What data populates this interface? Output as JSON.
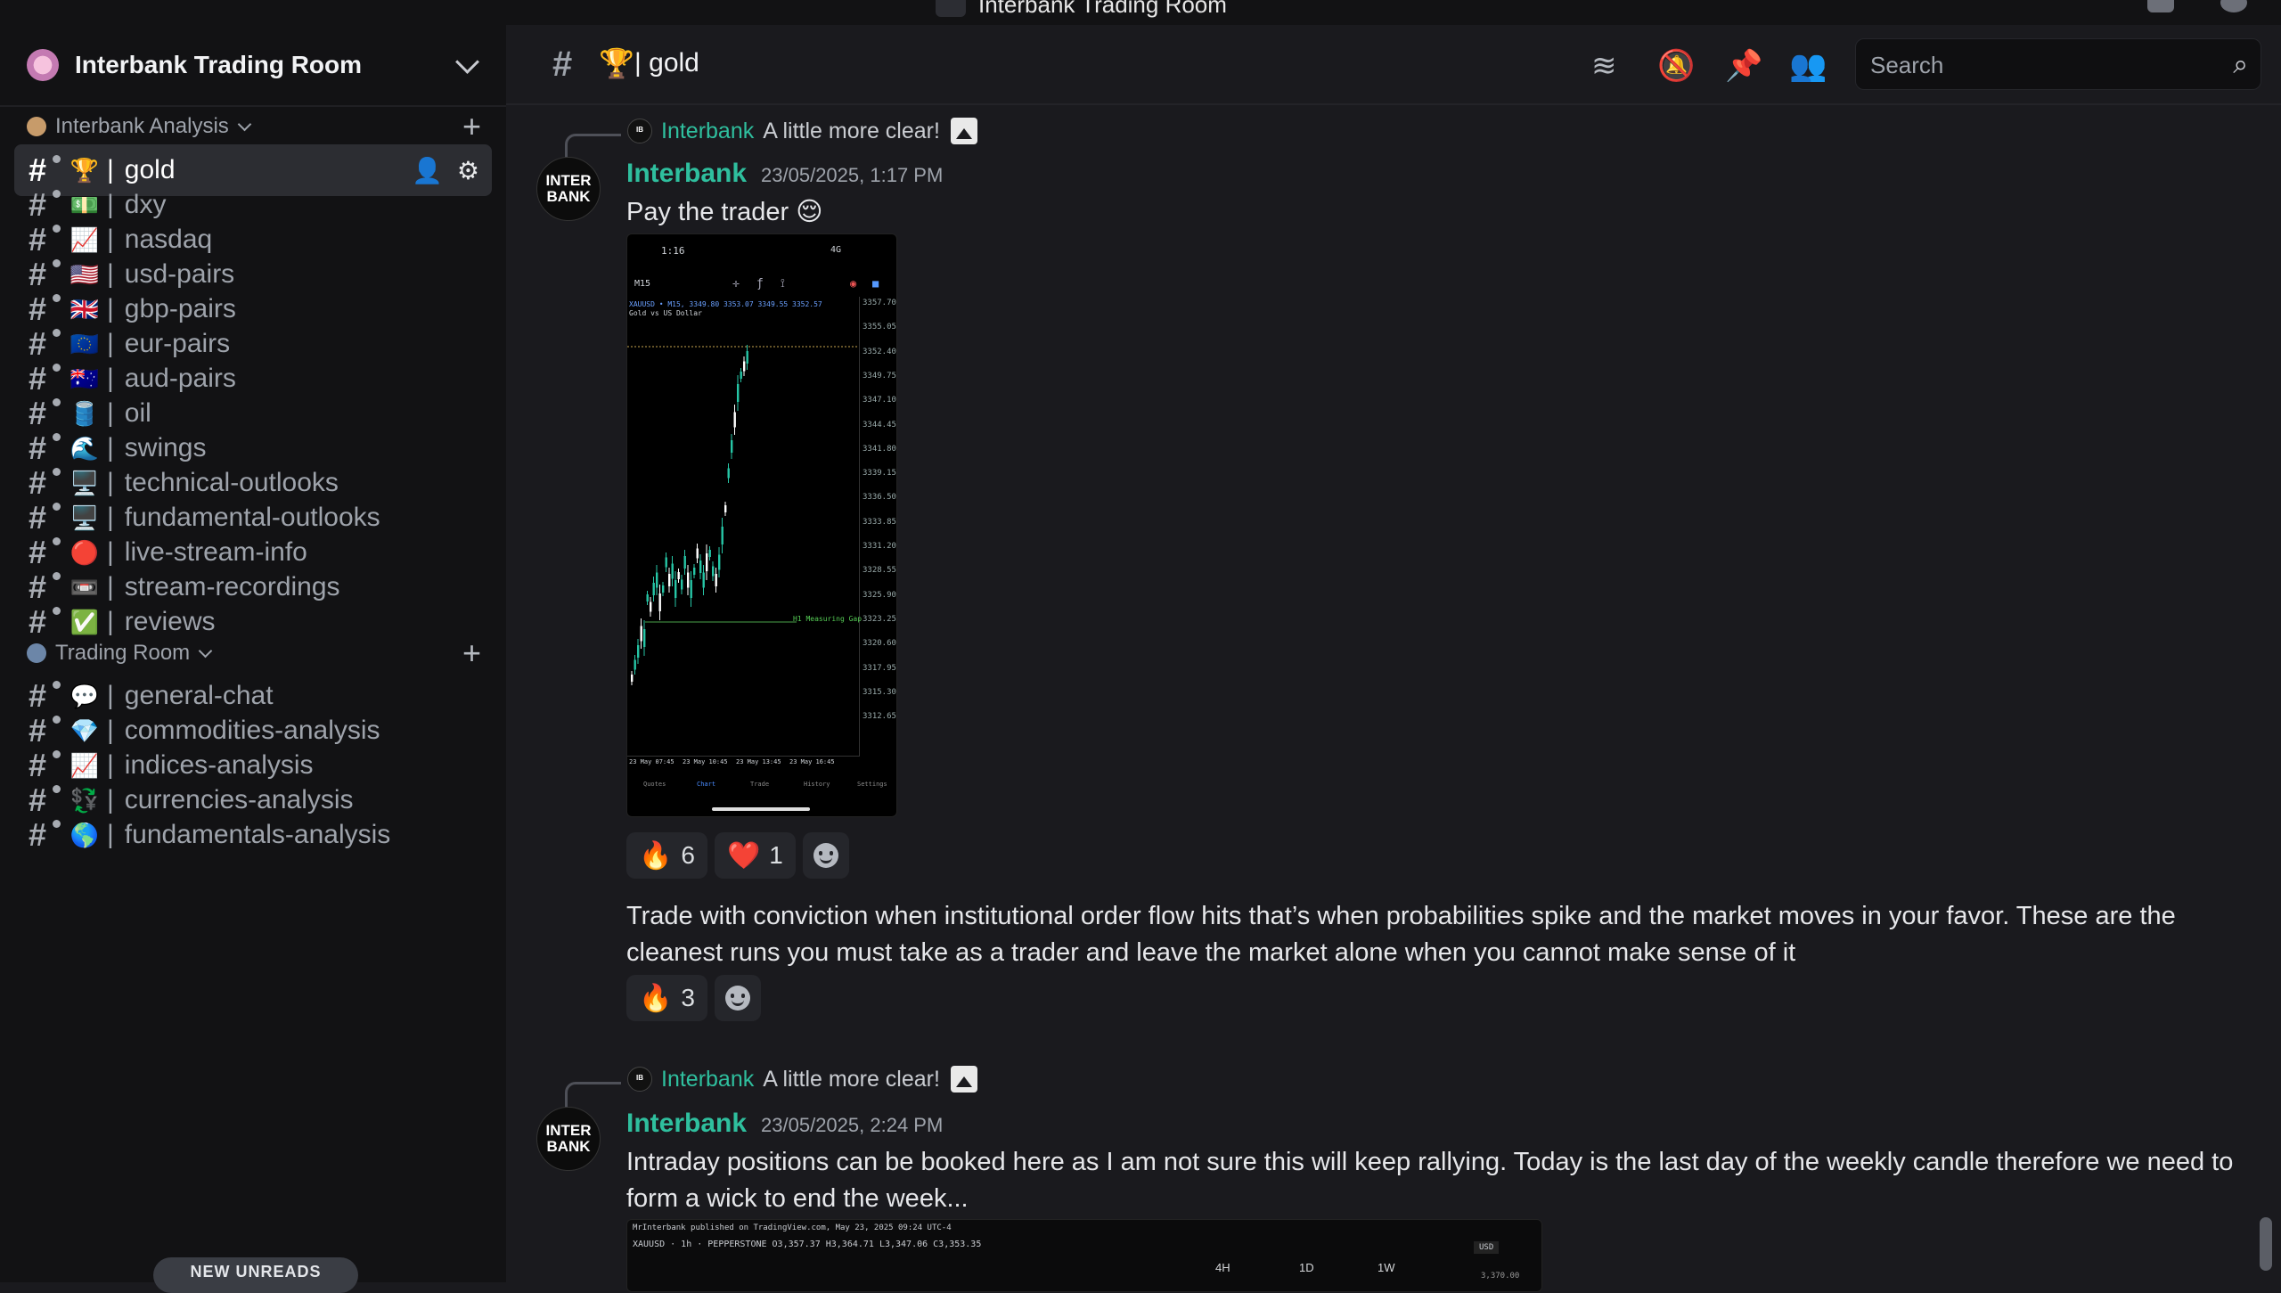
{
  "window": {
    "title": "Interbank Trading Room"
  },
  "server": {
    "name": "Interbank Trading Room"
  },
  "categories": [
    {
      "label": "Interbank Analysis"
    },
    {
      "label": "Trading Room"
    }
  ],
  "channels_analysis": [
    {
      "emoji": "🏆",
      "name": "gold",
      "active": true
    },
    {
      "emoji": "💵",
      "name": "dxy"
    },
    {
      "emoji": "📈",
      "name": "nasdaq"
    },
    {
      "emoji": "🇺🇸",
      "name": "usd-pairs"
    },
    {
      "emoji": "🇬🇧",
      "name": "gbp-pairs"
    },
    {
      "emoji": "🇪🇺",
      "name": "eur-pairs"
    },
    {
      "emoji": "🇦🇺",
      "name": "aud-pairs"
    },
    {
      "emoji": "🛢️",
      "name": "oil"
    },
    {
      "emoji": "🌊",
      "name": "swings"
    },
    {
      "emoji": "🖥️",
      "name": "technical-outlooks"
    },
    {
      "emoji": "🖥️",
      "name": "fundamental-outlooks"
    },
    {
      "emoji": "🔴",
      "name": "live-stream-info"
    },
    {
      "emoji": "📼",
      "name": "stream-recordings"
    },
    {
      "emoji": "✅",
      "name": "reviews"
    }
  ],
  "channels_trading": [
    {
      "emoji": "💬",
      "name": "general-chat"
    },
    {
      "emoji": "💎",
      "name": "commodities-analysis"
    },
    {
      "emoji": "📈",
      "name": "indices-analysis"
    },
    {
      "emoji": "💱",
      "name": "currencies-analysis"
    },
    {
      "emoji": "🌎",
      "name": "fundamentals-analysis"
    }
  ],
  "new_unreads": "NEW UNREADS",
  "channel_header": {
    "emoji": "🏆",
    "name": "gold",
    "separator": "|"
  },
  "search": {
    "placeholder": "Search"
  },
  "messages": [
    {
      "reply": {
        "author": "Interbank",
        "text": "A little more clear!"
      },
      "author": "Interbank",
      "timestamp": "23/05/2025, 1:17 PM",
      "text": "Pay the trader 😌",
      "image": {
        "status_time": "1:16",
        "status_net": "4G",
        "timeframe": "M15",
        "symbol_line": "XAUUSD • M15, 3349.80 3353.07 3349.55 3352.57",
        "symbol_desc": "Gold vs US Dollar",
        "price_labels": [
          "3357.70",
          "3355.05",
          "3352.40",
          "3349.75",
          "3347.10",
          "3344.45",
          "3341.80",
          "3339.15",
          "3336.50",
          "3333.85",
          "3331.20",
          "3328.55",
          "3325.90",
          "3323.25",
          "3320.60",
          "3317.95",
          "3315.30",
          "3312.65"
        ],
        "time_labels": [
          "23 May 07:45",
          "23 May 10:45",
          "23 May 13:45",
          "23 May 16:45"
        ],
        "annotation": "H1 Measuring Gap",
        "tabs": [
          "Quotes",
          "Chart",
          "Trade",
          "History",
          "Settings"
        ]
      },
      "reactions": [
        {
          "emoji": "🔥",
          "count": "6"
        },
        {
          "emoji": "❤️",
          "count": "1"
        }
      ]
    },
    {
      "text": "Trade with conviction when institutional order flow hits that’s when probabilities spike and the market moves in your favor. These are the cleanest runs you must take as a trader and leave the market alone when you cannot make sense of it",
      "reactions": [
        {
          "emoji": "🔥",
          "count": "3"
        }
      ]
    },
    {
      "reply": {
        "author": "Interbank",
        "text": "A little more clear!"
      },
      "author": "Interbank",
      "timestamp": "23/05/2025, 2:24 PM",
      "text": "Intraday positions can be booked here as I am not sure this will keep rallying. Today is the last day of the weekly candle therefore we need to form a wick to end the week...",
      "chart_preview": {
        "published": "MrInterbank published on TradingView.com, May 23, 2025 09:24 UTC-4",
        "symbol": "XAUUSD · 1h · PEPPERSTONE  O3,357.37 H3,364.71 L3,347.06 C3,353.35",
        "currency": "USD",
        "timeframes": [
          "4H",
          "1D",
          "1W"
        ],
        "price": "3,370.00"
      }
    }
  ],
  "avatar_text": "INTER BANK",
  "colors": {
    "accent_author": "#2fbf9e",
    "active_channel_bg": "#2c2d32"
  }
}
